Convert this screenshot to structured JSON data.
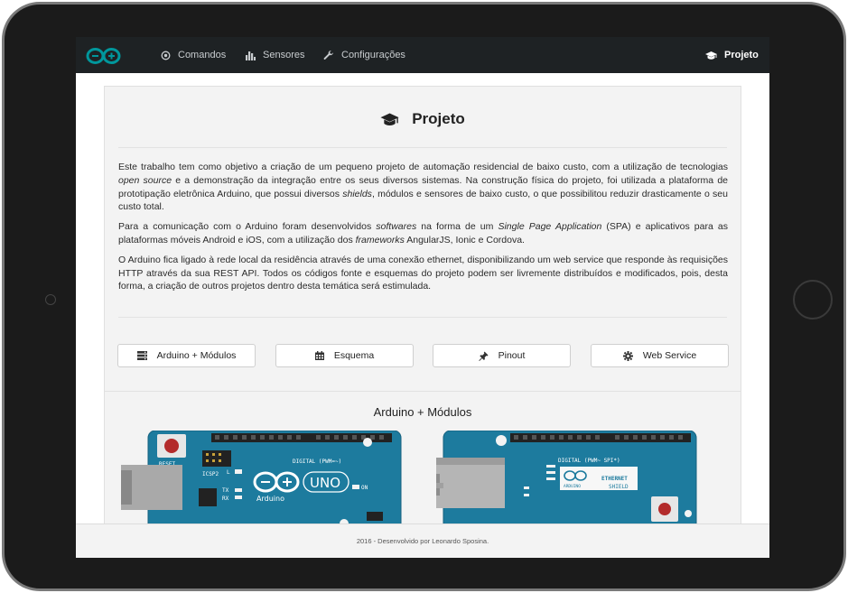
{
  "navbar": {
    "items": [
      {
        "label": "Comandos",
        "icon": "target-icon"
      },
      {
        "label": "Sensores",
        "icon": "bar-chart-icon"
      },
      {
        "label": "Configurações",
        "icon": "wrench-icon"
      }
    ],
    "right": {
      "label": "Projeto",
      "icon": "graduation-cap-icon"
    }
  },
  "page": {
    "title": "Projeto",
    "paragraph1": [
      "Este trabalho tem como objetivo a criação de um pequeno projeto de automação residencial de baixo custo, com a utilização de tecnologias ",
      "open source",
      " e a demonstração da integração entre os seus diversos sistemas. Na construção física do projeto, foi utilizada a plataforma de prototipação eletrônica Arduino, que possui diversos ",
      "shields",
      ", módulos e sensores de baixo custo, o que possibilitou reduzir drasticamente o seu custo total."
    ],
    "paragraph2": [
      "Para a comunicação com o Arduino foram desenvolvidos ",
      "softwares",
      " na forma de um ",
      "Single Page Application",
      " (SPA) e aplicativos para as plataformas móveis Android e iOS, com a utilização dos ",
      "frameworks",
      " AngularJS, Ionic e Cordova."
    ],
    "paragraph3": "O Arduino fica ligado à rede local da residência através de uma conexão ethernet, disponibilizando um web service que responde às requisições HTTP através da sua REST API. Todos os códigos fonte e esquemas do projeto podem ser livremente distribuídos e modificados, pois, desta forma, a criação de outros projetos dentro desta temática será estimulada.",
    "buttons": [
      {
        "label": "Arduino + Módulos",
        "icon": "server-icon"
      },
      {
        "label": "Esquema",
        "icon": "calendar-icon"
      },
      {
        "label": "Pinout",
        "icon": "pushpin-icon"
      },
      {
        "label": "Web Service",
        "icon": "gear-icon"
      }
    ],
    "section_title": "Arduino + Módulos"
  },
  "boards": {
    "uno": {
      "reset": "RESET",
      "icsp": "ICSP2",
      "brand": "Arduino",
      "model": "UNO",
      "digital": "DIGITAL (PWM=~)",
      "on": "ON",
      "tx": "TX",
      "rx": "RX",
      "l": "L"
    },
    "shield": {
      "title": "ETHERNET",
      "subtitle": "SHIELD",
      "brand": "ARDUINO",
      "digital": "DIGITAL (PWM~ SPI*)"
    }
  },
  "footer": "2016 - Desenvolvido por Leonardo Sposina.",
  "colors": {
    "navbar": "#1e2224",
    "board": "#1d7b9e",
    "logo": "#00979c",
    "panel": "#f3f3f3"
  }
}
